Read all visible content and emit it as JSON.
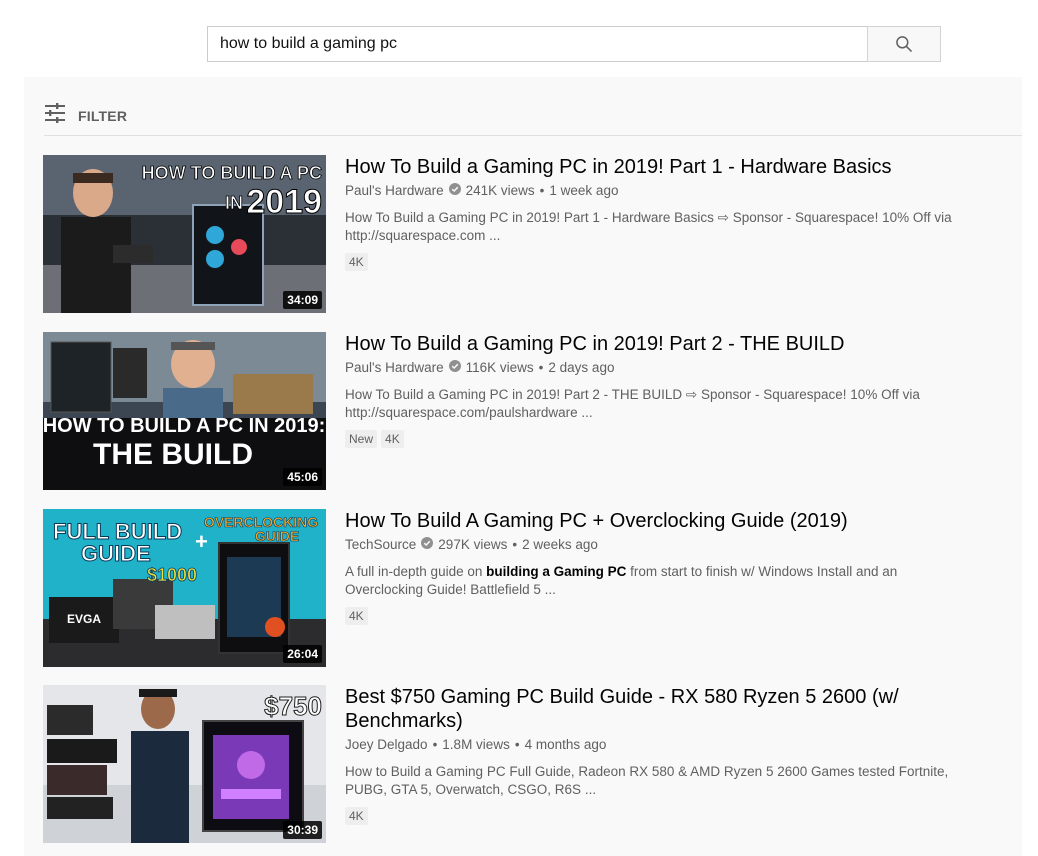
{
  "search": {
    "query": "how to build a gaming pc"
  },
  "filter": {
    "label": "FILTER"
  },
  "results": [
    {
      "title": "How To Build a Gaming PC in 2019! Part 1 - Hardware Basics",
      "channel": "Paul's Hardware",
      "verified": true,
      "views": "241K views",
      "age": "1 week ago",
      "description_line1": "How To Build a Gaming PC in 2019! Part 1 - Hardware Basics ⇨ Sponsor - Squarespace! 10% Off via",
      "description_line2": "http://squarespace.com ...",
      "badges": [
        "4K"
      ],
      "duration": "34:09",
      "thumb_text_1": "HOW TO BUILD A PC",
      "thumb_text_2": "IN",
      "thumb_text_3": "2019"
    },
    {
      "title": "How To Build a Gaming PC in 2019! Part 2 - THE BUILD",
      "channel": "Paul's Hardware",
      "verified": true,
      "views": "116K views",
      "age": "2 days ago",
      "description_line1": "How To Build a Gaming PC in 2019! Part 2 - THE BUILD ⇨ Sponsor - Squarespace! 10% Off via",
      "description_line2": "http://squarespace.com/paulshardware ...",
      "badges": [
        "New",
        "4K"
      ],
      "duration": "45:06",
      "thumb_text_1": "HOW TO BUILD A PC IN 2019:",
      "thumb_text_2": "THE BUILD"
    },
    {
      "title": "How To Build A Gaming PC + Overclocking Guide (2019)",
      "channel": "TechSource",
      "verified": true,
      "views": "297K views",
      "age": "2 weeks ago",
      "description_pre": "A full in-depth guide on ",
      "description_bold": "building a Gaming PC",
      "description_post": " from start to finish w/ Windows Install and an",
      "description_line2": "Overclocking Guide! Battlefield 5 ...",
      "badges": [
        "4K"
      ],
      "duration": "26:04",
      "thumb_text_1": "FULL BUILD",
      "thumb_text_2": "GUIDE",
      "thumb_text_3": "$1000",
      "thumb_text_4": "OVERCLOCKING",
      "thumb_text_5": "GUIDE",
      "thumb_text_6": "+",
      "thumb_text_7": "EVGA"
    },
    {
      "title_line1": "Best $750 Gaming PC Build Guide - RX 580 Ryzen 5 2600 (w/",
      "title_line2": "Benchmarks)",
      "channel": "Joey Delgado",
      "verified": false,
      "views": "1.8M views",
      "age": "4 months ago",
      "description_line1": "How to Build a Gaming PC Full Guide, Radeon RX 580 & AMD Ryzen 5 2600 Games tested Fortnite,",
      "description_line2": "PUBG, GTA 5, Overwatch, CSGO, R6S ...",
      "badges": [
        "4K"
      ],
      "duration": "30:39",
      "thumb_text_1": "$750"
    }
  ],
  "colors": {
    "title": "#030303",
    "meta": "#606060",
    "panel_bg": "#f9f9f9",
    "badge_bg": "#eeeeee",
    "duration_bg": "#000000"
  },
  "icons": {
    "search": "search-icon",
    "filter": "filter-sliders-icon",
    "verified": "verified-check-icon"
  }
}
